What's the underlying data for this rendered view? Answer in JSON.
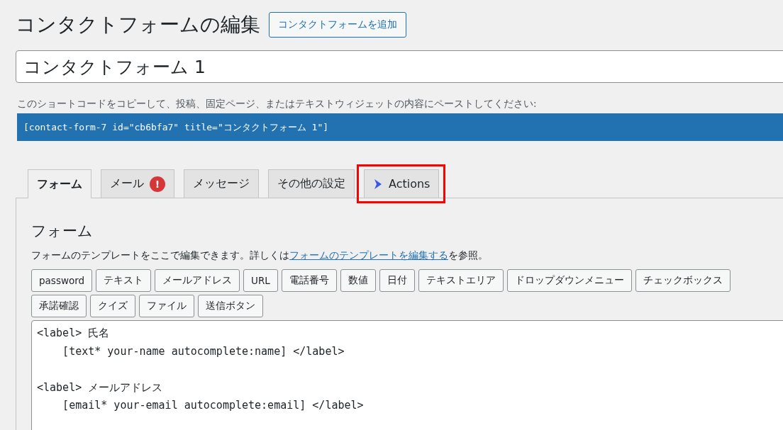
{
  "page": {
    "title": "コンタクトフォームの編集",
    "add_button": "コンタクトフォームを追加"
  },
  "form_title": {
    "value": "コンタクトフォーム 1"
  },
  "shortcode": {
    "hint": "このショートコードをコピーして、投稿、固定ページ、またはテキストウィジェットの内容にペーストしてください:",
    "code": "[contact-form-7 id=\"cb6bfa7\" title=\"コンタクトフォーム 1\"]"
  },
  "tabs": [
    {
      "label": "フォーム",
      "selected": true,
      "kind": "plain",
      "highlighted": false
    },
    {
      "label": "メール",
      "selected": false,
      "kind": "warning",
      "badge": "!",
      "highlighted": false
    },
    {
      "label": "メッセージ",
      "selected": false,
      "kind": "plain",
      "highlighted": false
    },
    {
      "label": "その他の設定",
      "selected": false,
      "kind": "plain",
      "highlighted": false
    },
    {
      "label": "Actions",
      "selected": false,
      "kind": "actions",
      "highlighted": true
    }
  ],
  "panel": {
    "heading": "フォーム",
    "description_before": "フォームのテンプレートをここで編集できます。詳しくは",
    "description_link": "フォームのテンプレートを編集する",
    "description_after": "を参照。",
    "tag_rows": [
      [
        "password",
        "テキスト",
        "メールアドレス",
        "URL",
        "電話番号",
        "数値",
        "日付",
        "テキストエリア",
        "ドロップダウンメニュー",
        "チェックボックス"
      ],
      [
        "承諾確認",
        "クイズ",
        "ファイル",
        "送信ボタン"
      ]
    ],
    "template": "<label> 氏名\n    [text* your-name autocomplete:name] </label>\n\n<label> メールアドレス\n    [email* your-email autocomplete:email] </label>"
  }
}
